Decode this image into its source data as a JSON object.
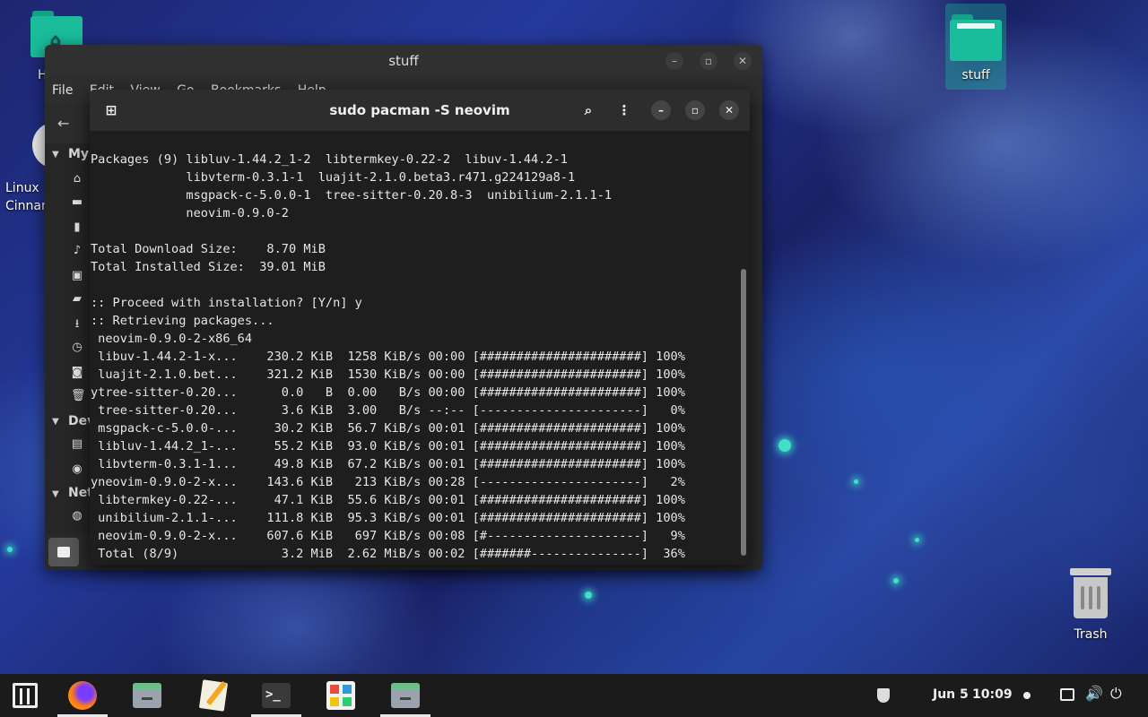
{
  "desktop": {
    "icons": [
      {
        "label": "H"
      },
      {
        "label": "Linux\nCinnam"
      },
      {
        "label": "stuff"
      },
      {
        "label": "Trash"
      }
    ]
  },
  "file_manager": {
    "title": "stuff",
    "menu": [
      "File",
      "Edit",
      "View",
      "Go",
      "Bookmarks",
      "Help"
    ],
    "sidebar": {
      "sections": [
        "My",
        "Dev",
        "Net"
      ]
    }
  },
  "terminal": {
    "title": "sudo pacman -S neovim",
    "lines": [
      "Packages (9) libluv-1.44.2_1-2  libtermkey-0.22-2  libuv-1.44.2-1",
      "             libvterm-0.3.1-1  luajit-2.1.0.beta3.r471.g224129a8-1",
      "             msgpack-c-5.0.0-1  tree-sitter-0.20.8-3  unibilium-2.1.1-1",
      "             neovim-0.9.0-2",
      "",
      "Total Download Size:    8.70 MiB",
      "Total Installed Size:  39.01 MiB",
      "",
      ":: Proceed with installation? [Y/n] y",
      ":: Retrieving packages...",
      " neovim-0.9.0-2-x86_64",
      " libuv-1.44.2-1-x...    230.2 KiB  1258 KiB/s 00:00 [######################] 100%",
      " luajit-2.1.0.bet...    321.2 KiB  1530 KiB/s 00:00 [######################] 100%",
      "ytree-sitter-0.20...      0.0   B  0.00   B/s 00:00 [######################] 100%",
      " tree-sitter-0.20...      3.6 KiB  3.00   B/s --:-- [----------------------]   0%",
      " msgpack-c-5.0.0-...     30.2 KiB  56.7 KiB/s 00:01 [######################] 100%",
      " libluv-1.44.2_1-...     55.2 KiB  93.0 KiB/s 00:01 [######################] 100%",
      " libvterm-0.3.1-1...     49.8 KiB  67.2 KiB/s 00:01 [######################] 100%",
      "yneovim-0.9.0-2-x...    143.6 KiB   213 KiB/s 00:28 [----------------------]   2%",
      " libtermkey-0.22-...     47.1 KiB  55.6 KiB/s 00:01 [######################] 100%",
      " unibilium-2.1.1-...    111.8 KiB  95.3 KiB/s 00:01 [######################] 100%",
      " neovim-0.9.0-2-x...    607.6 KiB   697 KiB/s 00:08 [#---------------------]   9%",
      " Total (8/9)              3.2 MiB  2.62 MiB/s 00:02 [#######---------------]  36%"
    ]
  },
  "taskbar": {
    "date": "Jun 5",
    "time": "10:09"
  }
}
